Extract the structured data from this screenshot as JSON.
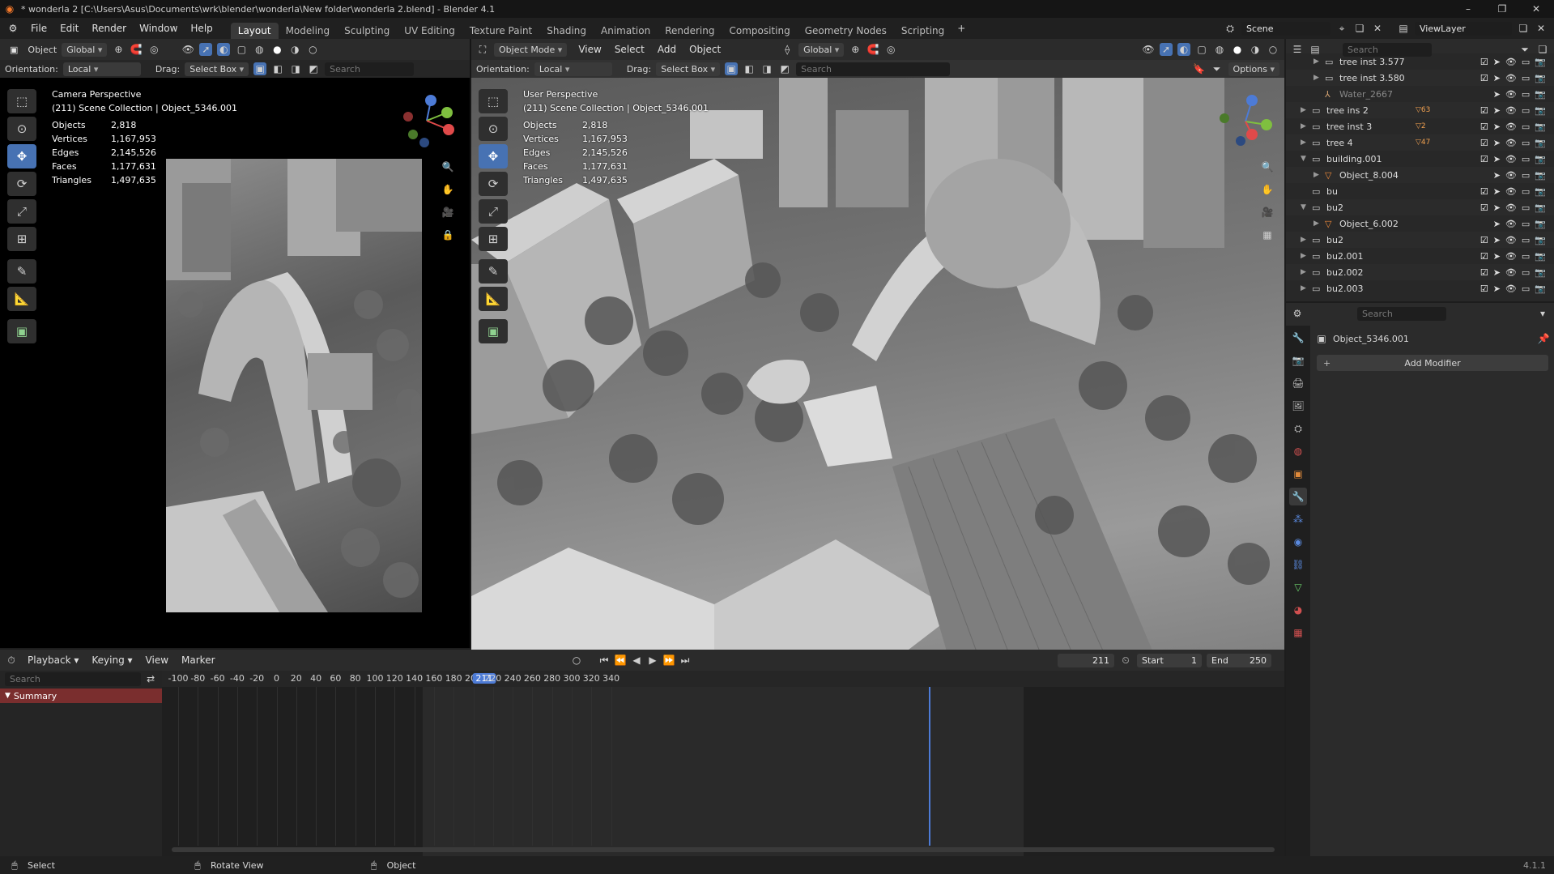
{
  "titlebar": {
    "title": "* wonderla 2 [C:\\Users\\Asus\\Documents\\wrk\\blender\\wonderla\\New folder\\wonderla 2.blend] - Blender 4.1"
  },
  "menu": [
    "File",
    "Edit",
    "Render",
    "Window",
    "Help"
  ],
  "workspaces": [
    "Layout",
    "Modeling",
    "Sculpting",
    "UV Editing",
    "Texture Paint",
    "Shading",
    "Animation",
    "Rendering",
    "Compositing",
    "Geometry Nodes",
    "Scripting"
  ],
  "active_workspace": "Layout",
  "scene_field": "Scene",
  "viewlayer_field": "ViewLayer",
  "left_viewport": {
    "mode_label": "Object",
    "transform": "Global",
    "orientation_label": "Orientation:",
    "orientation_value": "Local",
    "drag_label": "Drag:",
    "drag_value": "Select Box",
    "search_placeholder": "Search",
    "view_name": "Camera Perspective",
    "collection": "(211) Scene Collection | Object_5346.001",
    "stats": [
      {
        "label": "Objects",
        "value": "2,818"
      },
      {
        "label": "Vertices",
        "value": "1,167,953"
      },
      {
        "label": "Edges",
        "value": "2,145,526"
      },
      {
        "label": "Faces",
        "value": "1,177,631"
      },
      {
        "label": "Triangles",
        "value": "1,497,635"
      }
    ]
  },
  "main_viewport": {
    "mode": "Object Mode",
    "menus": [
      "View",
      "Select",
      "Add",
      "Object"
    ],
    "transform": "Global",
    "orientation_label": "Orientation:",
    "orientation_value": "Local",
    "drag_label": "Drag:",
    "drag_value": "Select Box",
    "search_placeholder": "Search",
    "options": "Options",
    "view_name": "User Perspective",
    "collection": "(211) Scene Collection | Object_5346.001",
    "stats": [
      {
        "label": "Objects",
        "value": "2,818"
      },
      {
        "label": "Vertices",
        "value": "1,167,953"
      },
      {
        "label": "Edges",
        "value": "2,145,526"
      },
      {
        "label": "Faces",
        "value": "1,177,631"
      },
      {
        "label": "Triangles",
        "value": "1,497,635"
      }
    ]
  },
  "outliner": {
    "search_placeholder": "Search",
    "items": [
      {
        "name": "tree inst 3.577",
        "indent": 1,
        "icon": "collection"
      },
      {
        "name": "tree inst 3.580",
        "indent": 1,
        "icon": "collection"
      },
      {
        "name": "Water_2667",
        "indent": 1,
        "icon": "armature",
        "dim": true
      },
      {
        "name": "tree ins 2",
        "indent": 0,
        "icon": "collection",
        "badge": "63"
      },
      {
        "name": "tree inst 3",
        "indent": 0,
        "icon": "collection",
        "badge": "2"
      },
      {
        "name": "tree 4",
        "indent": 0,
        "icon": "collection",
        "badge": "47"
      },
      {
        "name": "building.001",
        "indent": 0,
        "icon": "collection"
      },
      {
        "name": "Object_8.004",
        "indent": 1,
        "icon": "mesh"
      },
      {
        "name": "bu",
        "indent": 0,
        "icon": "collection"
      },
      {
        "name": "bu2",
        "indent": 0,
        "icon": "collection"
      },
      {
        "name": "Object_6.002",
        "indent": 1,
        "icon": "mesh"
      },
      {
        "name": "bu2",
        "indent": 0,
        "icon": "collection"
      },
      {
        "name": "bu2.001",
        "indent": 0,
        "icon": "collection"
      },
      {
        "name": "bu2.002",
        "indent": 0,
        "icon": "collection"
      },
      {
        "name": "bu2.003",
        "indent": 0,
        "icon": "collection"
      }
    ]
  },
  "properties": {
    "search_placeholder": "Search",
    "object_name": "Object_5346.001",
    "add_modifier": "Add Modifier"
  },
  "timeline": {
    "menus": [
      "Playback",
      "Keying",
      "View",
      "Marker"
    ],
    "current_frame": "211",
    "start_label": "Start",
    "start_value": "1",
    "end_label": "End",
    "end_value": "250",
    "search_placeholder": "Search",
    "summary": "Summary",
    "ruler": [
      "-100",
      "-80",
      "-60",
      "-40",
      "-20",
      "0",
      "20",
      "40",
      "60",
      "80",
      "100",
      "120",
      "140",
      "160",
      "180",
      "200",
      "211",
      "220",
      "240",
      "260",
      "280",
      "300",
      "320",
      "340"
    ]
  },
  "statusbar": {
    "select": "Select",
    "rotate": "Rotate View",
    "object": "Object",
    "version": "4.1.1"
  }
}
